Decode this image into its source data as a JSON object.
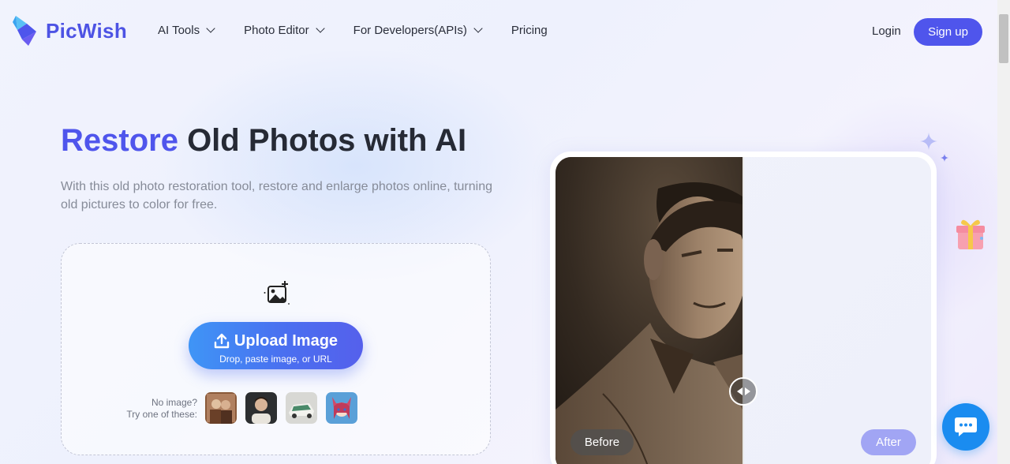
{
  "brand": {
    "name": "PicWish",
    "accent": "#4f55ec"
  },
  "nav": {
    "items": [
      {
        "label": "AI Tools",
        "has_dropdown": true
      },
      {
        "label": "Photo Editor",
        "has_dropdown": true
      },
      {
        "label": "For Developers(APIs)",
        "has_dropdown": true
      },
      {
        "label": "Pricing",
        "has_dropdown": false
      }
    ],
    "login_label": "Login",
    "signup_label": "Sign up"
  },
  "hero": {
    "title_accent": "Restore",
    "title_rest": " Old Photos with AI",
    "subtitle": "With this old photo restoration tool, restore and enlarge photos online, turning old pictures to color for free."
  },
  "upload": {
    "icon": "add-image-icon",
    "button_label": "Upload Image",
    "button_sub": "Drop, paste image, or URL",
    "sample_label_line1": "No image?",
    "sample_label_line2": "Try one of these:",
    "samples": [
      "sample-couple-photo",
      "sample-portrait-photo",
      "sample-car-photo",
      "sample-anime-girl-photo"
    ]
  },
  "comparison": {
    "before_label": "Before",
    "after_label": "After",
    "split_fraction": 0.5
  },
  "widgets": {
    "chat_icon": "chat-bubble-icon",
    "gift_icon": "gift-icon"
  }
}
